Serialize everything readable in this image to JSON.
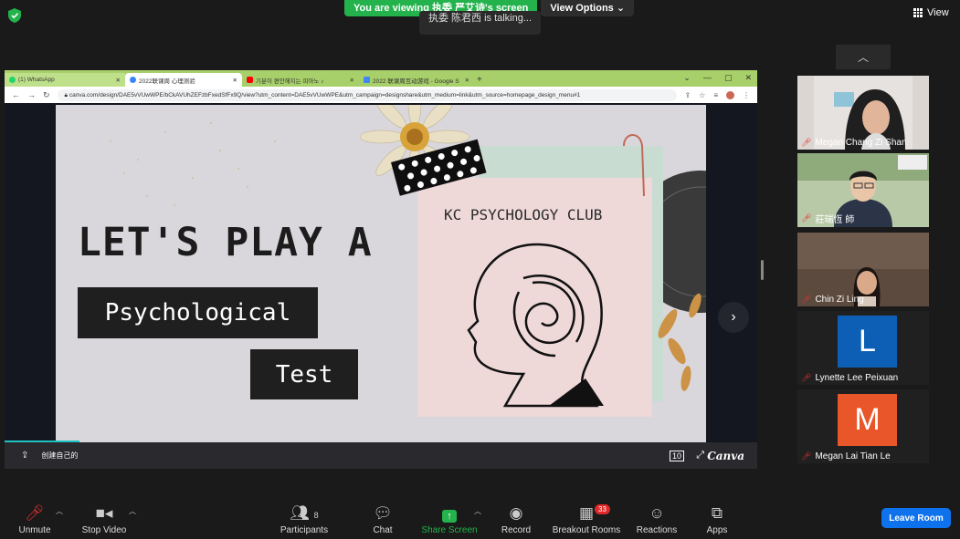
{
  "top": {
    "banner": "You are viewing 执委 严艾诗's screen",
    "view_options": "View Options",
    "talking": "执委 陈君西 is talking...",
    "view": "View"
  },
  "browser": {
    "tabs": [
      {
        "label": "(1) WhatsApp",
        "color": "#25d366"
      },
      {
        "label": "2022联课周 心理测验",
        "color": "#3a86ff"
      },
      {
        "label": "기분이 편안해지는 피아노 ♪",
        "color": "#ff0000"
      },
      {
        "label": "2022 联课周互动游戏 - Google S",
        "color": "#4285f4"
      }
    ],
    "url": "canva.com/design/DAE5vVUwWPE/bCkAVUhZEFzbFxedSfFx9Q/view?utm_content=DAE5vVUwWPE&utm_campaign=designshare&utm_medium=link&utm_source=homepage_design_menu#1"
  },
  "slide": {
    "title": "LET'S PLAY A",
    "box1": "Psychological",
    "box2": "Test",
    "club": "KC PSYCHOLOGY CLUB"
  },
  "canva": {
    "left_text": "创建自己的",
    "logo": "Canva"
  },
  "participants": [
    {
      "name": "Megan Chang Zi Shan",
      "type": "video",
      "bg": "#c8b8b0"
    },
    {
      "name": "莊瑞恆 師",
      "type": "video",
      "bg": "#9fb896"
    },
    {
      "name": "Chin Zi Ling",
      "type": "video",
      "bg": "#6b5a4e"
    },
    {
      "name": "Lynette Lee Peixuan",
      "type": "avatar",
      "letter": "L",
      "bg": "#0d5fb5"
    },
    {
      "name": "Megan Lai Tian Le",
      "type": "avatar",
      "letter": "M",
      "bg": "#e8562a"
    }
  ],
  "toolbar": {
    "unmute": "Unmute",
    "stop_video": "Stop Video",
    "participants": "Participants",
    "participants_count": "8",
    "chat": "Chat",
    "share_screen": "Share Screen",
    "record": "Record",
    "breakout": "Breakout Rooms",
    "breakout_count": "33",
    "reactions": "Reactions",
    "apps": "Apps",
    "leave": "Leave Room"
  }
}
